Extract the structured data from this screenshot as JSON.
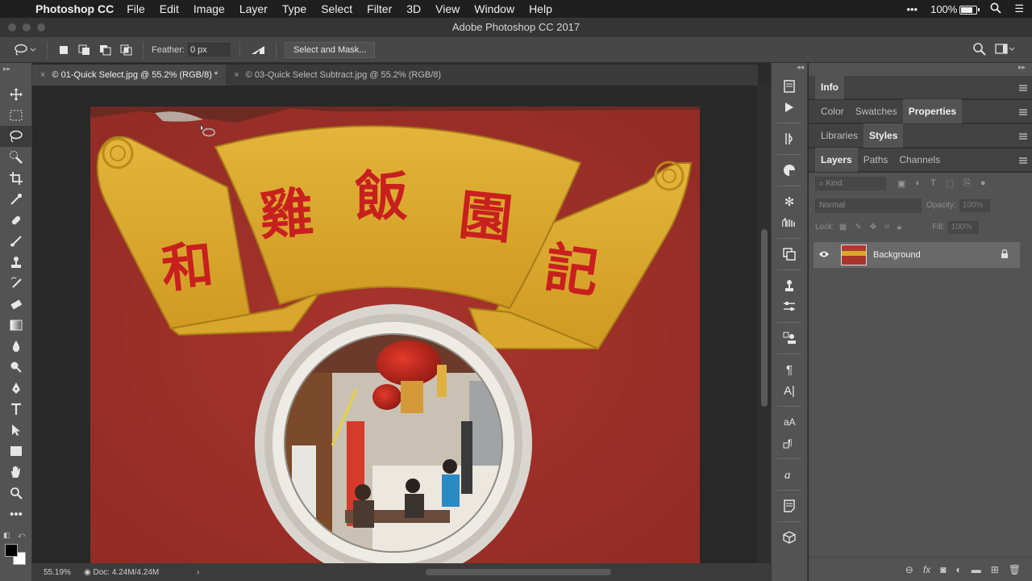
{
  "menubar": {
    "app_name": "Photoshop CC",
    "items": [
      "File",
      "Edit",
      "Image",
      "Layer",
      "Type",
      "Select",
      "Filter",
      "3D",
      "View",
      "Window",
      "Help"
    ],
    "more": "•••",
    "battery": "100%"
  },
  "window": {
    "title": "Adobe Photoshop CC 2017"
  },
  "options": {
    "feather_label": "Feather:",
    "feather_value": "0 px",
    "select_mask_label": "Select and Mask..."
  },
  "tabs": [
    {
      "label": "01-Quick Select.jpg @ 55.2% (RGB/8) *",
      "active": true
    },
    {
      "label": "03-Quick Select Subtract.jpg @ 55.2% (RGB/8)",
      "active": false
    }
  ],
  "status": {
    "zoom": "55.19%",
    "doc": "Doc: 4.24M/4.24M"
  },
  "panels": {
    "row1": [
      "Info"
    ],
    "row2": [
      "Color",
      "Swatches",
      "Properties"
    ],
    "row3": [
      "Libraries",
      "Styles"
    ],
    "row4": [
      "Layers",
      "Paths",
      "Channels"
    ],
    "kind_label": "Kind",
    "blend_mode": "Normal",
    "opacity_label": "Opacity:",
    "opacity_value": "100%",
    "lock_label": "Lock:",
    "fill_label": "Fill:",
    "fill_value": "100%"
  },
  "layer": {
    "name": "Background"
  },
  "sign": {
    "chars": [
      "和",
      "雞",
      "飯",
      "園",
      "記"
    ]
  },
  "colors": {
    "accent_red": "#a8342c",
    "sign_yellow": "#d9a72a",
    "text_red": "#c8201e"
  },
  "icons": {
    "toolbar": [
      "move-icon",
      "marquee-icon",
      "lasso-icon",
      "quick-select-icon",
      "crop-icon",
      "eyedropper-icon",
      "healing-icon",
      "brush-icon",
      "stamp-icon",
      "history-brush-icon",
      "eraser-icon",
      "gradient-icon",
      "blur-icon",
      "dodge-icon",
      "pen-icon",
      "type-icon",
      "path-select-icon",
      "shape-icon",
      "hand-icon",
      "zoom-icon",
      "more-tools-icon"
    ]
  }
}
